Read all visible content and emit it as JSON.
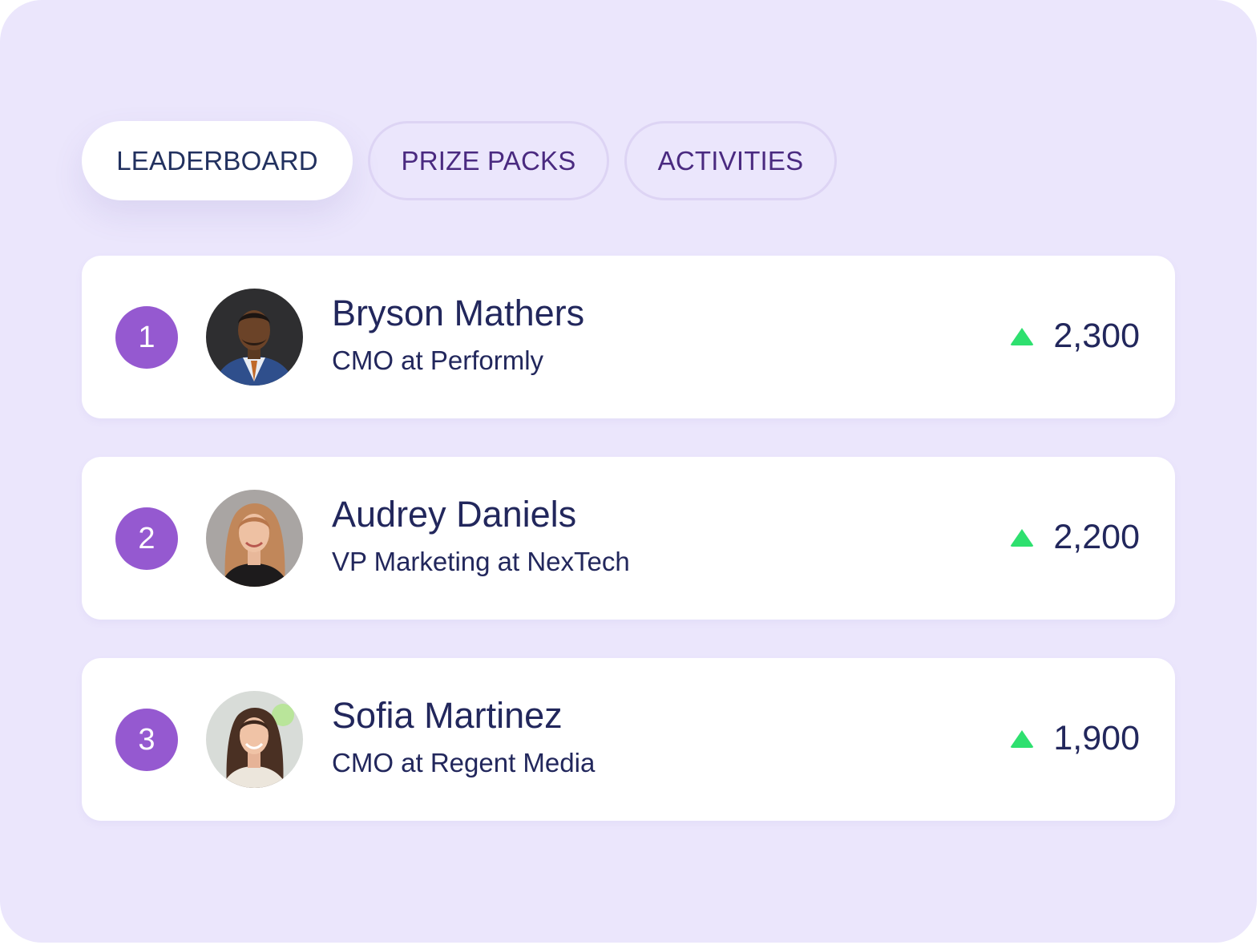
{
  "tabs": [
    {
      "label": "LEADERBOARD",
      "active": true
    },
    {
      "label": "PRIZE PACKS",
      "active": false
    },
    {
      "label": "ACTIVITIES",
      "active": false
    }
  ],
  "leaderboard": [
    {
      "rank": "1",
      "name": "Bryson Mathers",
      "role": "CMO at Performly",
      "score": "2,300",
      "trend": "up"
    },
    {
      "rank": "2",
      "name": "Audrey Daniels",
      "role": "VP Marketing at NexTech",
      "score": "2,200",
      "trend": "up"
    },
    {
      "rank": "3",
      "name": "Sofia Martinez",
      "role": "CMO at Regent Media",
      "score": "1,900",
      "trend": "up"
    }
  ],
  "colors": {
    "background": "#ebe6fc",
    "rank_badge": "#9559d0",
    "trend_up": "#2ee06f",
    "text_dark": "#22275c",
    "tab_text": "#4a2a80"
  },
  "icons": {
    "trend": "triangle-up-icon",
    "avatar": "person-photo"
  }
}
